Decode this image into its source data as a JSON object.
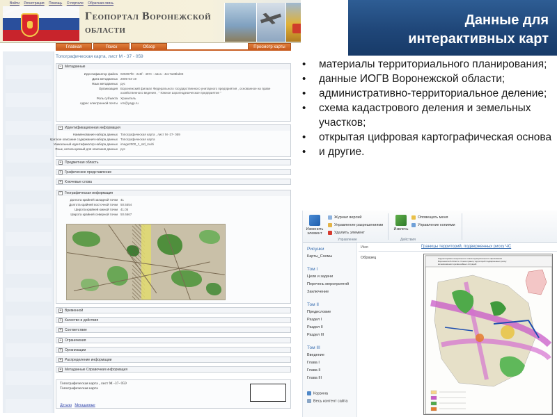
{
  "geoportal": {
    "top_links": [
      "Войти",
      "Регистрация",
      "Помощь",
      "О портале",
      "Обратная связь"
    ],
    "title_line1": "Геопортал Воронежской",
    "title_line2": "области",
    "nav": {
      "main": "Главная",
      "search": "Поиск",
      "overview": "Обзор",
      "view_map": "Просмотр карты"
    },
    "doc_title": "Топографическая карта, лист М - 37 - 059",
    "metadata_section": {
      "header": "Метаданные",
      "rows": [
        {
          "key": "Идентификатор файла",
          "value": "025097f8 - 2e5f - 497c - a5ca - 4ec7a38bd33"
        },
        {
          "key": "Дата метаданных",
          "value": "2005-04-19"
        },
        {
          "key": "Язык метаданных",
          "value": "рус"
        },
        {
          "key": "Организация",
          "value": "Воронежский филиал Федерального государственного унитарного предприятия , основанное на праве хозяйственного ведения , \" Южное аэрогеодезическое предприятие \""
        },
        {
          "key": "Роль субъекта",
          "value": "Хранитель"
        },
        {
          "key": "Адрес электронной почты",
          "value": "vrn@yagp.ru"
        }
      ]
    },
    "ident_section": {
      "header": "Идентификационная информация",
      "rows": [
        {
          "key": "Наименование набора данных",
          "value": "Топографическая карта , лист М -37- 059"
        },
        {
          "key": "Краткое описание содержания набора данных",
          "value": "Топографическая карта"
        },
        {
          "key": "Уникальный идентификатор набора данных",
          "value": "image2000_1_std_multi"
        },
        {
          "key": "Язык, используемый для описания данных",
          "value": "рус"
        }
      ]
    },
    "collapsed_sections_top": [
      "Предметная область",
      "Графическое представление",
      "Ключевые слова"
    ],
    "geo_section": {
      "header": "Географическая информация",
      "rows": [
        {
          "key": "Долгота крайней западной точки",
          "value": "41"
        },
        {
          "key": "Долгота крайней восточной точки",
          "value": "50.5554"
        },
        {
          "key": "Широта крайней южной точки",
          "value": "41.05"
        },
        {
          "key": "Широта крайней северной точки",
          "value": "50.6667"
        }
      ]
    },
    "collapsed_sections_bottom": [
      "Временной",
      "Качество и действия",
      "Соответствие",
      "Ограничения",
      "Организации",
      "Распределение информации",
      "Метаданные Справочная информация"
    ],
    "footer": {
      "line1": "Топографическая карта , лист М -37- 059",
      "line2": "Топографическая карта",
      "links": [
        "Детали",
        "Метаданные"
      ]
    }
  },
  "slide": {
    "title_line1": "Данные для",
    "title_line2": "интерактивных карт",
    "bullets": [
      "материалы территориального планирования;",
      "данные ИОГВ Воронежской области;",
      "административно-территориальное деление;",
      "схема кадастрового деления и земельных участков;",
      "открытая цифровая картографическая основа",
      "и другие."
    ]
  },
  "sharepoint": {
    "ribbon": {
      "edit_item": "Изменить элемент",
      "version_log": "Журнал версий",
      "manage_permissions": "Управление разрешениями",
      "delete_item": "Удалить элемент",
      "group_manage": "Управление",
      "extract": "Извлечь",
      "alert_me": "Оповещать меня",
      "manage_copies": "Управление копиями",
      "group_actions": "Действия"
    },
    "nav": {
      "pictures_head": "Рисунки",
      "maps_schemes": "Карты_Схемы",
      "vol1": "Том I",
      "vol1_items": [
        "Цели и задачи",
        "Перечень мероприятий",
        "Заключение"
      ],
      "vol2": "Том II",
      "vol2_items": [
        "Предисловие",
        "Раздел I",
        "Раздел II",
        "Раздел III"
      ],
      "vol3": "Том III",
      "vol3_items": [
        "Введение",
        "Глава I",
        "Глава II",
        "Глава III"
      ],
      "recycle": "Корзина",
      "all_content": "Весь контент сайта"
    },
    "col_name": "Имя",
    "sample": "Образец",
    "doc_title": "Границы территорий, подверженных риску ЧС",
    "plan_heading": "Корректировка генерального плана муниципального образования Воронежской области. Схема границ территорий подверженных риску возникновения чрезвычайных ситуаций"
  },
  "colors": {
    "slide_header": "#1f4678",
    "nav_orange": "#c85c1f",
    "link_blue": "#3a6fb0"
  }
}
